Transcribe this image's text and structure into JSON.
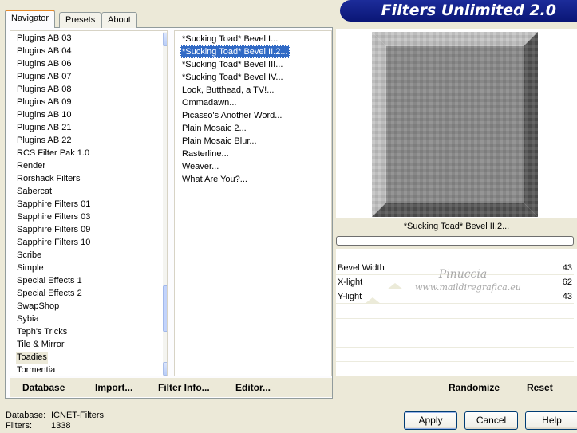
{
  "tabs": [
    "Navigator",
    "Presets",
    "About"
  ],
  "header_title": "Filters Unlimited 2.0",
  "categories": [
    "Plugins AB 03",
    "Plugins AB 04",
    "Plugins AB 06",
    "Plugins AB 07",
    "Plugins AB 08",
    "Plugins AB 09",
    "Plugins AB 10",
    "Plugins AB 21",
    "Plugins AB 22",
    "RCS Filter Pak 1.0",
    "Render",
    "Rorshack Filters",
    "Sabercat",
    "Sapphire Filters 01",
    "Sapphire Filters 03",
    "Sapphire Filters 09",
    "Sapphire Filters 10",
    "Scribe",
    "Simple",
    "Special Effects 1",
    "Special Effects 2",
    "SwapShop",
    "Sybia",
    "Teph's Tricks",
    "Tile & Mirror",
    "Toadies",
    "Tormentia"
  ],
  "selected_category": "Toadies",
  "filters": [
    "*Sucking Toad*  Bevel I...",
    "*Sucking Toad*  Bevel II.2...",
    "*Sucking Toad*  Bevel III...",
    "*Sucking Toad*  Bevel IV...",
    "Look, Butthead, a TV!...",
    "Ommadawn...",
    "Picasso's Another Word...",
    "Plain Mosaic 2...",
    "Plain Mosaic Blur...",
    "Rasterline...",
    "Weaver...",
    "What Are You?..."
  ],
  "selected_filter": "*Sucking Toad*  Bevel II.2...",
  "left_toolbar": {
    "database": "Database",
    "import": "Import...",
    "filter_info": "Filter Info...",
    "editor": "Editor..."
  },
  "preview_filter_name": "*Sucking Toad*  Bevel II.2...",
  "params": [
    {
      "label": "Bevel Width",
      "value": "43"
    },
    {
      "label": "X-light",
      "value": "62"
    },
    {
      "label": "Y-light",
      "value": "43"
    }
  ],
  "watermark": {
    "line1": "Pinuccia",
    "line2": "www.maildiregrafica.eu"
  },
  "right_toolbar": {
    "randomize": "Randomize",
    "reset": "Reset"
  },
  "status": {
    "database_label": "Database:",
    "database_value": "ICNET-Filters",
    "filters_label": "Filters:",
    "filters_value": "1338"
  },
  "buttons": {
    "apply": "Apply",
    "cancel": "Cancel",
    "help": "Help"
  },
  "colors": {
    "selection": "#316ac5",
    "header_bg": "#0a1676",
    "tab_accent": "#e68b2c"
  }
}
